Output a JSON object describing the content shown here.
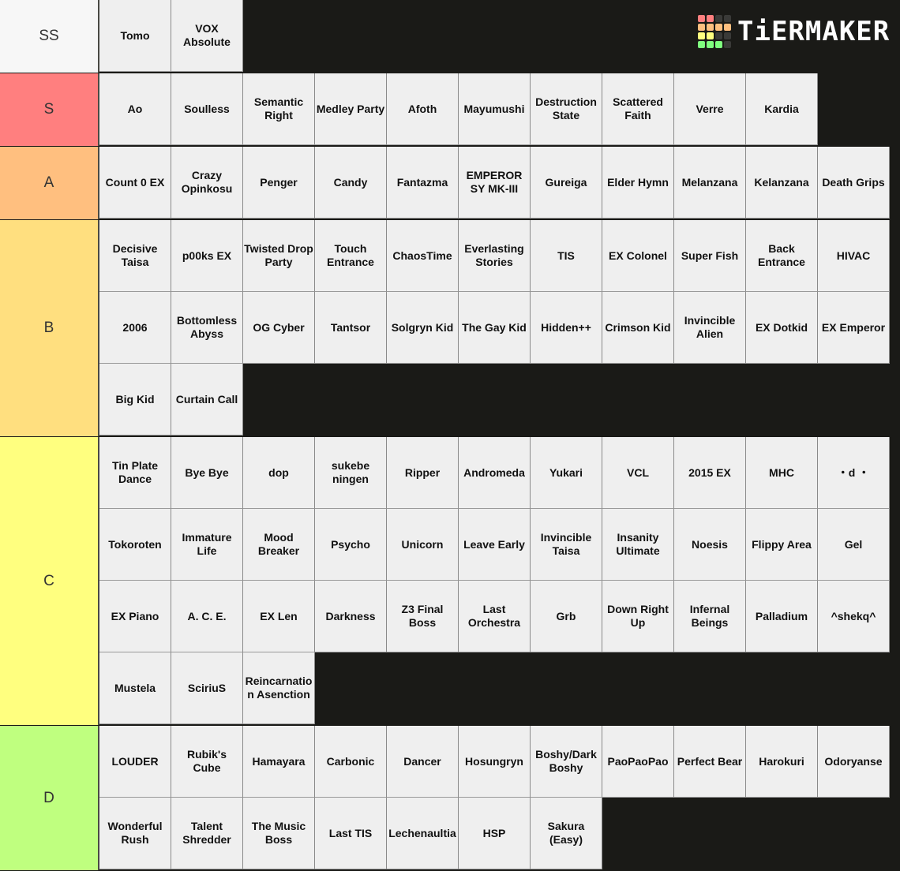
{
  "logo": {
    "text": "TiERMAKER",
    "grid_colors": [
      "#ff7f7f",
      "#ff7f7f",
      "#3a3a38",
      "#3a3a38",
      "#ffbf7f",
      "#ffbf7f",
      "#ffbf7f",
      "#ffbf7f",
      "#ffff7f",
      "#ffff7f",
      "#3a3a38",
      "#3a3a38",
      "#7fff7f",
      "#7fff7f",
      "#7fff7f",
      "#3a3a38"
    ]
  },
  "tiers": [
    {
      "label": "SS",
      "color": "#f7f7f7",
      "items": [
        "Tomo",
        "VOX Absolute"
      ]
    },
    {
      "label": "S",
      "color": "#ff7f7f",
      "items": [
        "Ao",
        "Soulless",
        "Semantic Right",
        "Medley Party",
        "Afoth",
        "Mayumushi",
        "Destruction State",
        "Scattered Faith",
        "Verre",
        "Kardia"
      ]
    },
    {
      "label": "A",
      "color": "#ffbf7f",
      "items": [
        "Count 0 EX",
        "Crazy Opinkosu",
        "Penger",
        "Candy",
        "Fantazma",
        "EMPEROR SY MK-III",
        "Gureiga",
        "Elder Hymn",
        "Melanzana",
        "Kelanzana",
        "Death Grips"
      ]
    },
    {
      "label": "B",
      "color": "#ffdf7f",
      "items": [
        "Decisive Taisa",
        "p00ks EX",
        "Twisted Drop Party",
        "Touch Entrance",
        "ChaosTime",
        "Everlasting Stories",
        "TIS",
        "EX Colonel",
        "Super Fish",
        "Back Entrance",
        "HIVAC",
        "2006",
        "Bottomless Abyss",
        "OG Cyber",
        "Tantsor",
        "Solgryn Kid",
        "The Gay Kid",
        "Hidden++",
        "Crimson Kid",
        "Invincible Alien",
        "EX Dotkid",
        "EX Emperor",
        "Big Kid",
        "Curtain Call"
      ]
    },
    {
      "label": "C",
      "color": "#ffff7f",
      "items": [
        "Tin Plate Dance",
        "Bye Bye",
        "dop",
        "sukebe ningen",
        "Ripper",
        "Andromeda",
        "Yukari",
        "VCL",
        "2015 EX",
        "MHC",
        "・d ・",
        "Tokoroten",
        "Immature Life",
        "Mood Breaker",
        "Psycho",
        "Unicorn",
        "Leave Early",
        "Invincible Taisa",
        "Insanity Ultimate",
        "Noesis",
        "Flippy Area",
        "Gel",
        "EX Piano",
        "A. C. E.",
        "EX Len",
        "Darkness",
        "Z3 Final Boss",
        "Last Orchestra",
        "Grb",
        "Down Right Up",
        "Infernal Beings",
        "Palladium",
        "^shekq^",
        "Mustela",
        "SciriuS",
        "Reincarnation Asenction"
      ]
    },
    {
      "label": "D",
      "color": "#bfff7f",
      "items": [
        "LOUDER",
        "Rubik's Cube",
        "Hamayara",
        "Carbonic",
        "Dancer",
        "Hosungryn",
        "Boshy/Dark Boshy",
        "PaoPaoPao",
        "Perfect Bear",
        "Harokuri",
        "Odoryanse",
        "Wonderful Rush",
        "Talent Shredder",
        "The Music Boss",
        "Last TIS",
        "Lechenaultia",
        "HSP",
        "Sakura (Easy)"
      ]
    }
  ]
}
